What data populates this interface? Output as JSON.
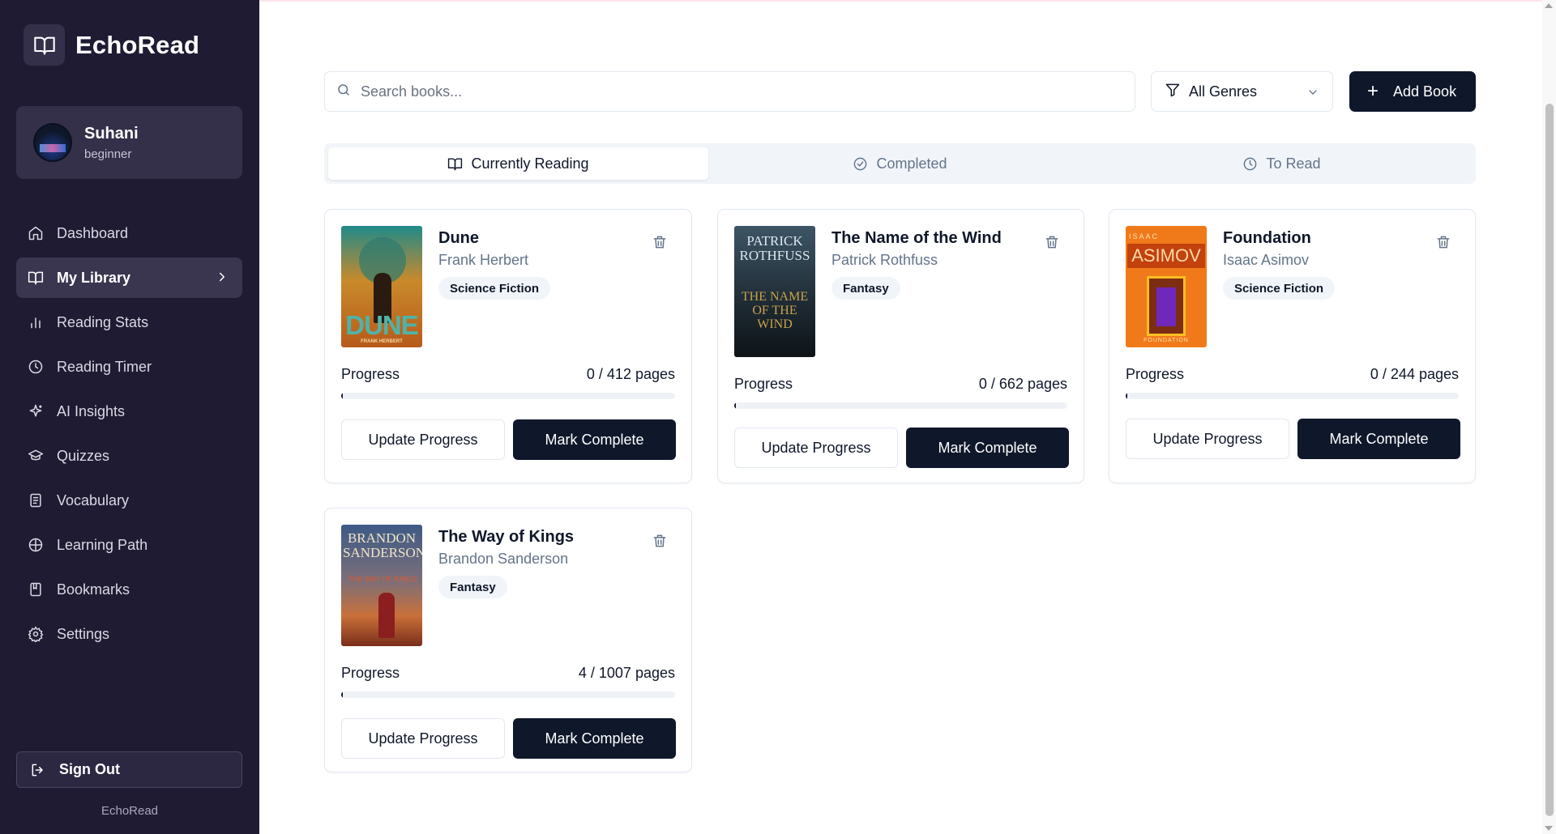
{
  "app": {
    "name": "EchoRead",
    "footer": "EchoRead"
  },
  "user": {
    "name": "Suhani",
    "level": "beginner"
  },
  "sidebar": {
    "items": [
      {
        "label": "Dashboard",
        "icon": "home-icon"
      },
      {
        "label": "My Library",
        "icon": "book-open-icon",
        "active": true
      },
      {
        "label": "Reading Stats",
        "icon": "bar-chart-icon"
      },
      {
        "label": "Reading Timer",
        "icon": "clock-icon"
      },
      {
        "label": "AI Insights",
        "icon": "sparkles-icon"
      },
      {
        "label": "Quizzes",
        "icon": "graduation-cap-icon"
      },
      {
        "label": "Vocabulary",
        "icon": "notebook-icon"
      },
      {
        "label": "Learning Path",
        "icon": "compass-icon"
      },
      {
        "label": "Bookmarks",
        "icon": "bookmark-icon"
      },
      {
        "label": "Settings",
        "icon": "gear-icon"
      }
    ],
    "signout": "Sign Out"
  },
  "toolbar": {
    "search_placeholder": "Search books...",
    "genre_filter": "All Genres",
    "add_book": "Add Book"
  },
  "tabs": [
    {
      "label": "Currently Reading",
      "active": true
    },
    {
      "label": "Completed"
    },
    {
      "label": "To Read"
    }
  ],
  "books": [
    {
      "title": "Dune",
      "author": "Frank Herbert",
      "genre": "Science Fiction",
      "progress_label": "Progress",
      "pages": "0 / 412 pages",
      "progress": 0.0,
      "update_label": "Update Progress",
      "complete_label": "Mark Complete",
      "cover_text": "DUNE",
      "cover_sub": "FRANK HERBERT"
    },
    {
      "title": "The Name of the Wind",
      "author": "Patrick Rothfuss",
      "genre": "Fantasy",
      "progress_label": "Progress",
      "pages": "0 / 662 pages",
      "progress": 0.0,
      "update_label": "Update Progress",
      "complete_label": "Mark Complete",
      "cover_text": "PATRICK ROTHFUSS",
      "cover_sub": "THE NAME OF THE WIND"
    },
    {
      "title": "Foundation",
      "author": "Isaac Asimov",
      "genre": "Science Fiction",
      "progress_label": "Progress",
      "pages": "0 / 244 pages",
      "progress": 0.0,
      "update_label": "Update Progress",
      "complete_label": "Mark Complete",
      "cover_text": "ASIMOV",
      "cover_sub": "ISAAC",
      "cover_foot": "FOUNDATION"
    },
    {
      "title": "The Way of Kings",
      "author": "Brandon Sanderson",
      "genre": "Fantasy",
      "progress_label": "Progress",
      "pages": "4 / 1007 pages",
      "progress": 0.004,
      "update_label": "Update Progress",
      "complete_label": "Mark Complete",
      "cover_text": "BRANDON SANDERSON",
      "cover_sub": "THE WAY OF KINGS"
    }
  ],
  "colors": {
    "sidebar_bg": "#1f1b33",
    "primary": "#0f172a",
    "muted": "#64748b",
    "accent_surface": "#f1f5f9"
  }
}
